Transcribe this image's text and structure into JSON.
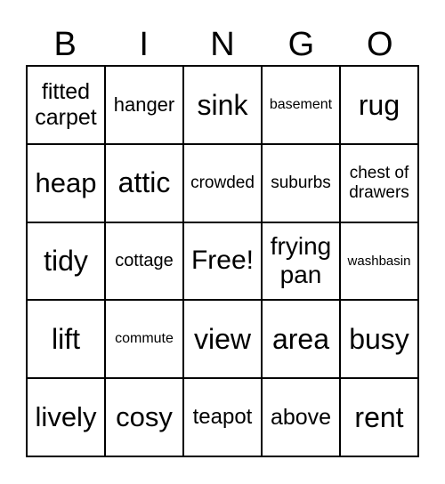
{
  "header": [
    "B",
    "I",
    "N",
    "G",
    "O"
  ],
  "cells": [
    [
      "fitted carpet",
      "hanger",
      "sink",
      "basement",
      "rug"
    ],
    [
      "heap",
      "attic",
      "crowded",
      "suburbs",
      "chest of drawers"
    ],
    [
      "tidy",
      "cottage",
      "Free!",
      "frying pan",
      "washbasin"
    ],
    [
      "lift",
      "commute",
      "view",
      "area",
      "busy"
    ],
    [
      "lively",
      "cosy",
      "teapot",
      "above",
      "rent"
    ]
  ]
}
